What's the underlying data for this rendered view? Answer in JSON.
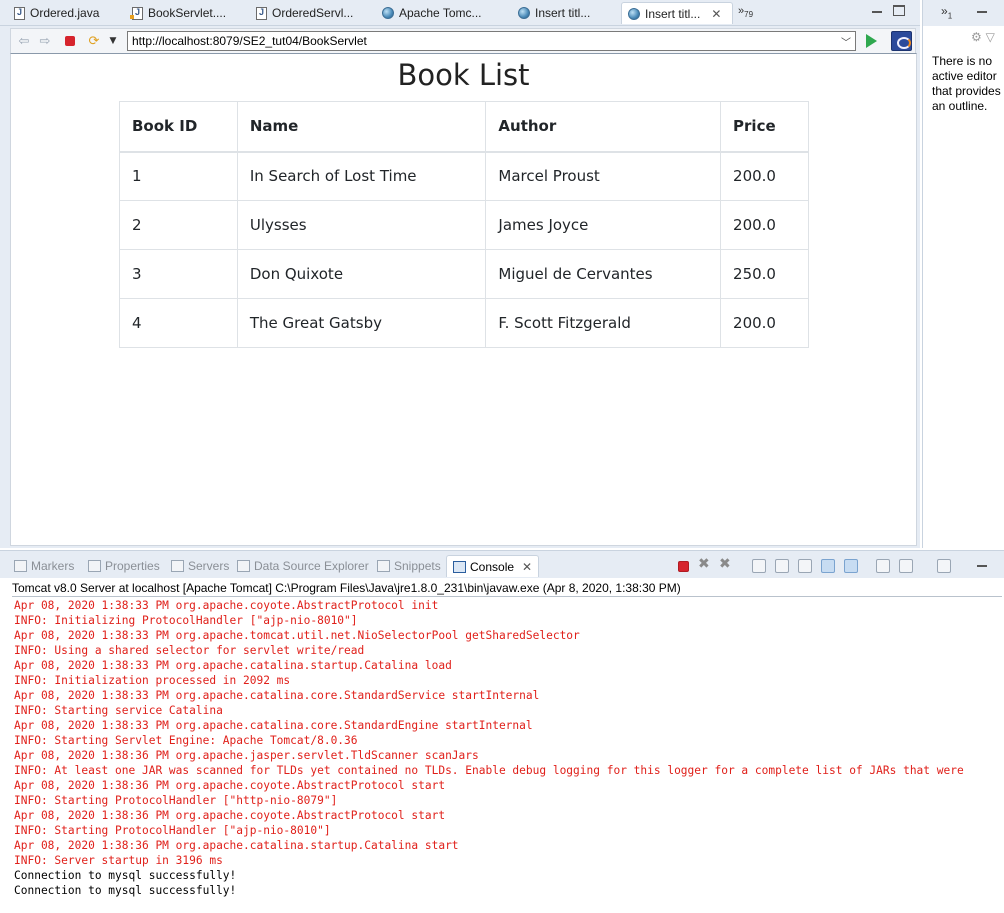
{
  "editor_tabs": [
    {
      "label": "Ordered.java",
      "icon": "java-file-icon"
    },
    {
      "label": "BookServlet....",
      "icon": "java-file-icon"
    },
    {
      "label": "OrderedServl...",
      "icon": "java-file-icon"
    },
    {
      "label": "Apache Tomc...",
      "icon": "globe-icon"
    },
    {
      "label": "Insert titl...",
      "icon": "globe-icon"
    },
    {
      "label": "Insert titl...",
      "icon": "globe-icon",
      "active": true
    }
  ],
  "more_tabs": {
    "chevron": "»",
    "count": "79"
  },
  "browser": {
    "url": "http://localhost:8079/SE2_tut04/BookServlet"
  },
  "page": {
    "title": "Book List",
    "columns": [
      "Book ID",
      "Name",
      "Author",
      "Price"
    ],
    "rows": [
      [
        "1",
        "In Search of Lost Time",
        "Marcel Proust",
        "200.0"
      ],
      [
        "2",
        "Ulysses",
        "James Joyce",
        "200.0"
      ],
      [
        "3",
        "Don Quixote",
        "Miguel de Cervantes",
        "250.0"
      ],
      [
        "4",
        "The Great Gatsby",
        "F. Scott Fitzgerald",
        "200.0"
      ]
    ]
  },
  "outline": {
    "chevron": "»",
    "count": "1",
    "message": "There is no active editor that provides an outline."
  },
  "bottom_tabs": [
    {
      "label": "Markers",
      "icon": "markers-icon"
    },
    {
      "label": "Properties",
      "icon": "properties-icon"
    },
    {
      "label": "Servers",
      "icon": "servers-icon"
    },
    {
      "label": "Data Source Explorer",
      "icon": "data-source-icon"
    },
    {
      "label": "Snippets",
      "icon": "snippets-icon"
    },
    {
      "label": "Console",
      "icon": "console-icon",
      "active": true
    }
  ],
  "console": {
    "header": "Tomcat v8.0 Server at localhost [Apache Tomcat] C:\\Program Files\\Java\\jre1.8.0_231\\bin\\javaw.exe (Apr 8, 2020, 1:38:30 PM)",
    "lines": [
      {
        "text": "Apr 08, 2020 1:38:33 PM org.apache.coyote.AbstractProtocol init",
        "level": "err"
      },
      {
        "text": "INFO: Initializing ProtocolHandler [\"ajp-nio-8010\"]",
        "level": "err"
      },
      {
        "text": "Apr 08, 2020 1:38:33 PM org.apache.tomcat.util.net.NioSelectorPool getSharedSelector",
        "level": "err"
      },
      {
        "text": "INFO: Using a shared selector for servlet write/read",
        "level": "err"
      },
      {
        "text": "Apr 08, 2020 1:38:33 PM org.apache.catalina.startup.Catalina load",
        "level": "err"
      },
      {
        "text": "INFO: Initialization processed in 2092 ms",
        "level": "err"
      },
      {
        "text": "Apr 08, 2020 1:38:33 PM org.apache.catalina.core.StandardService startInternal",
        "level": "err"
      },
      {
        "text": "INFO: Starting service Catalina",
        "level": "err"
      },
      {
        "text": "Apr 08, 2020 1:38:33 PM org.apache.catalina.core.StandardEngine startInternal",
        "level": "err"
      },
      {
        "text": "INFO: Starting Servlet Engine: Apache Tomcat/8.0.36",
        "level": "err"
      },
      {
        "text": "Apr 08, 2020 1:38:36 PM org.apache.jasper.servlet.TldScanner scanJars",
        "level": "err"
      },
      {
        "text": "INFO: At least one JAR was scanned for TLDs yet contained no TLDs. Enable debug logging for this logger for a complete list of JARs that were",
        "level": "err"
      },
      {
        "text": "Apr 08, 2020 1:38:36 PM org.apache.coyote.AbstractProtocol start",
        "level": "err"
      },
      {
        "text": "INFO: Starting ProtocolHandler [\"http-nio-8079\"]",
        "level": "err"
      },
      {
        "text": "Apr 08, 2020 1:38:36 PM org.apache.coyote.AbstractProtocol start",
        "level": "err"
      },
      {
        "text": "INFO: Starting ProtocolHandler [\"ajp-nio-8010\"]",
        "level": "err"
      },
      {
        "text": "Apr 08, 2020 1:38:36 PM org.apache.catalina.startup.Catalina start",
        "level": "err"
      },
      {
        "text": "INFO: Server startup in 3196 ms",
        "level": "err"
      },
      {
        "text": "Connection to mysql successfully!",
        "level": "out"
      },
      {
        "text": "Connection to mysql successfully!",
        "level": "out"
      }
    ]
  },
  "colors": {
    "stderr": "#e0201a",
    "stdout": "#000000",
    "chrome": "#e6ecf4"
  }
}
